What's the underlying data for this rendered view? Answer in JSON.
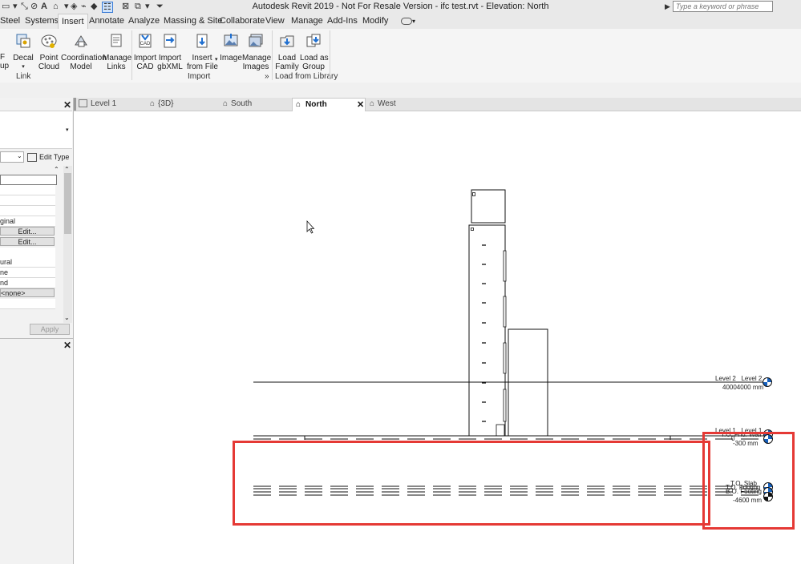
{
  "titlebar": {
    "title": "Autodesk Revit 2019 - Not For Resale Version - ifc test.rvt - Elevation: North",
    "search_placeholder": "Type a keyword or phrase"
  },
  "ribbon_tabs": [
    "Steel",
    "Systems",
    "Insert",
    "Annotate",
    "Analyze",
    "Massing & Site",
    "Collaborate",
    "View",
    "Manage",
    "Add-Ins",
    "Modify"
  ],
  "ribbon": {
    "link_group": {
      "label": "Link",
      "partial_label_1": "F",
      "partial_label_2": "up",
      "decal": "Decal",
      "point_cloud": [
        "Point",
        "Cloud"
      ],
      "coordination_model": [
        "Coordination",
        "Model"
      ],
      "manage_links": [
        "Manage",
        "Links"
      ]
    },
    "import_group": {
      "label": "Import",
      "import_cad": [
        "Import",
        "CAD"
      ],
      "import_gbxml": [
        "Import",
        "gbXML"
      ],
      "insert_from_file": [
        "Insert",
        "from File"
      ],
      "image": "Image",
      "manage_images": [
        "Manage",
        "Images"
      ],
      "expander": "»"
    },
    "library_group": {
      "label": "Load from Library",
      "load_family": [
        "Load",
        "Family"
      ],
      "load_as_group": [
        "Load as",
        "Group"
      ]
    },
    "icon_labels": {
      "cad": "CAD"
    }
  },
  "properties": {
    "edit_type": "Edit Type",
    "rows": [
      "",
      "",
      "",
      "",
      "ginal",
      "Edit...",
      "Edit...",
      "",
      "ural",
      "ne",
      "nd",
      "<none>",
      ""
    ],
    "apply": "Apply"
  },
  "view_tabs": [
    {
      "label": "Level 1",
      "icon": "floor-plan-icon",
      "active": false
    },
    {
      "label": "{3D}",
      "icon": "3d-view-icon",
      "active": false
    },
    {
      "label": "South",
      "icon": "elevation-icon",
      "active": false
    },
    {
      "label": "North",
      "icon": "elevation-icon",
      "active": true
    },
    {
      "label": "West",
      "icon": "elevation-icon",
      "active": false
    }
  ],
  "levels": {
    "level2": {
      "name_a": "Level 2",
      "name_b": "Level 2",
      "elev": "40004000 mm"
    },
    "level1": {
      "name_a": "Level 1",
      "name_b": "Level 1",
      "sub": "T.O. Fnd. Wall",
      "elev_a": "0 ",
      "elev_b": "-300 mm"
    },
    "footing": {
      "a": "T.O. Slab",
      "b": "T.O. Footing",
      "c": "B.O. Footing",
      "elev": "-4600 mm"
    }
  },
  "colors": {
    "accent": "#1560bd",
    "highlight": "#e53935"
  }
}
